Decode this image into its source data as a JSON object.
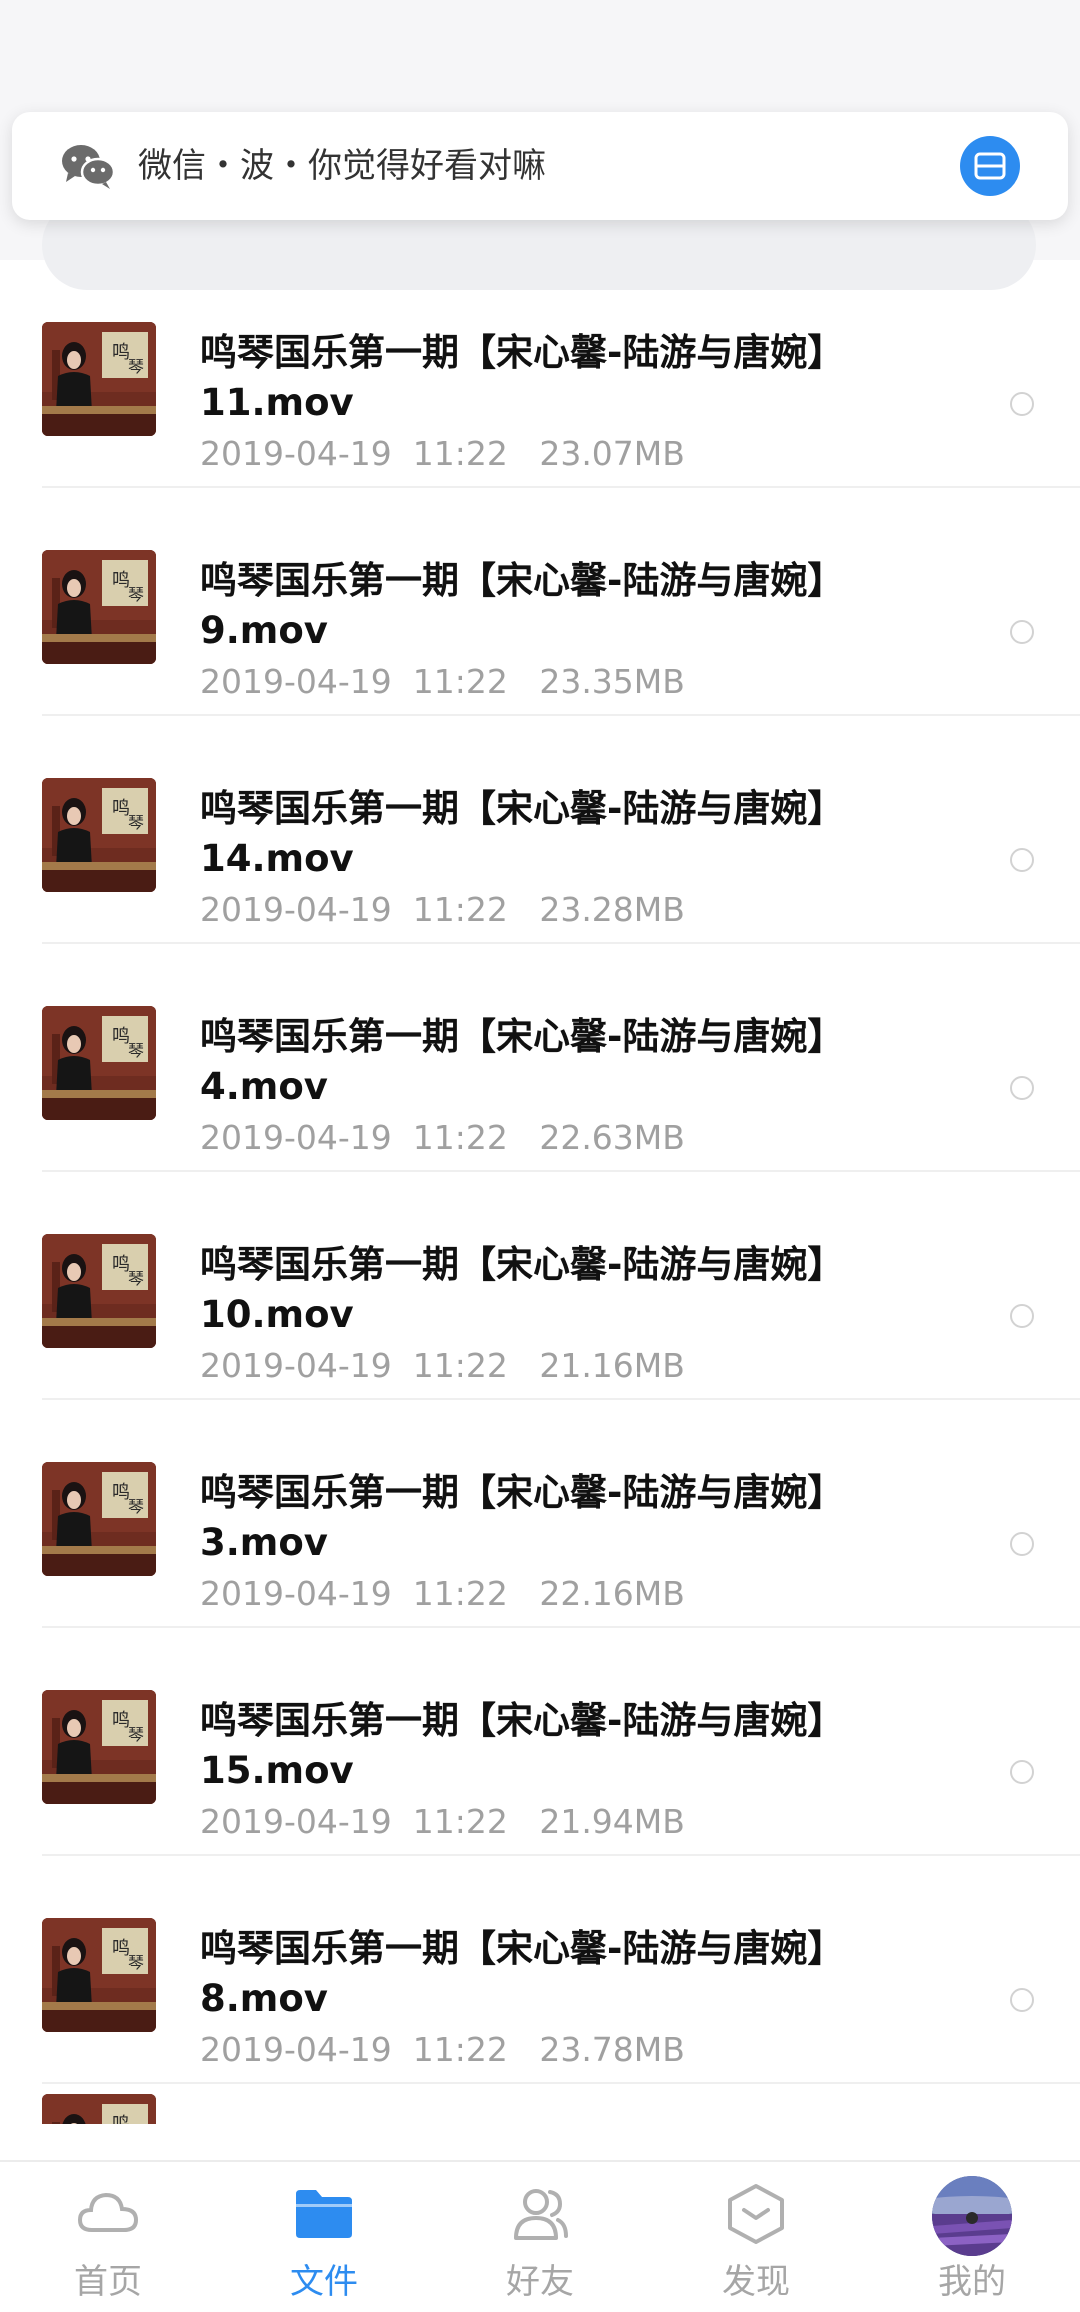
{
  "notification": {
    "text": "微信・波・你觉得好看对嘛",
    "app_icon": "wechat-icon",
    "action_icon": "expand-icon",
    "accent": "#2d8cf0"
  },
  "files": [
    {
      "title": "鸣琴国乐第一期【宋心馨-陆游与唐婉】11.mov",
      "meta": "2019-04-19  11:22   23.07MB"
    },
    {
      "title": "鸣琴国乐第一期【宋心馨-陆游与唐婉】9.mov",
      "meta": "2019-04-19  11:22   23.35MB"
    },
    {
      "title": "鸣琴国乐第一期【宋心馨-陆游与唐婉】14.mov",
      "meta": "2019-04-19  11:22   23.28MB"
    },
    {
      "title": "鸣琴国乐第一期【宋心馨-陆游与唐婉】4.mov",
      "meta": "2019-04-19  11:22   22.63MB"
    },
    {
      "title": "鸣琴国乐第一期【宋心馨-陆游与唐婉】10.mov",
      "meta": "2019-04-19  11:22   21.16MB"
    },
    {
      "title": "鸣琴国乐第一期【宋心馨-陆游与唐婉】3.mov",
      "meta": "2019-04-19  11:22   22.16MB"
    },
    {
      "title": "鸣琴国乐第一期【宋心馨-陆游与唐婉】15.mov",
      "meta": "2019-04-19  11:22   21.94MB"
    },
    {
      "title": "鸣琴国乐第一期【宋心馨-陆游与唐婉】8.mov",
      "meta": "2019-04-19  11:22   23.78MB"
    }
  ],
  "tabs": [
    {
      "label": "首页",
      "icon": "cloud-icon",
      "active": false
    },
    {
      "label": "文件",
      "icon": "folder-icon",
      "active": true
    },
    {
      "label": "好友",
      "icon": "friends-icon",
      "active": false
    },
    {
      "label": "发现",
      "icon": "discover-icon",
      "active": false
    },
    {
      "label": "我的",
      "icon": "avatar",
      "active": false
    }
  ],
  "colors": {
    "accent": "#2d8cf0",
    "inactive": "#a6a6a6",
    "meta_text": "#a0a0a0",
    "title_text": "#111111"
  }
}
